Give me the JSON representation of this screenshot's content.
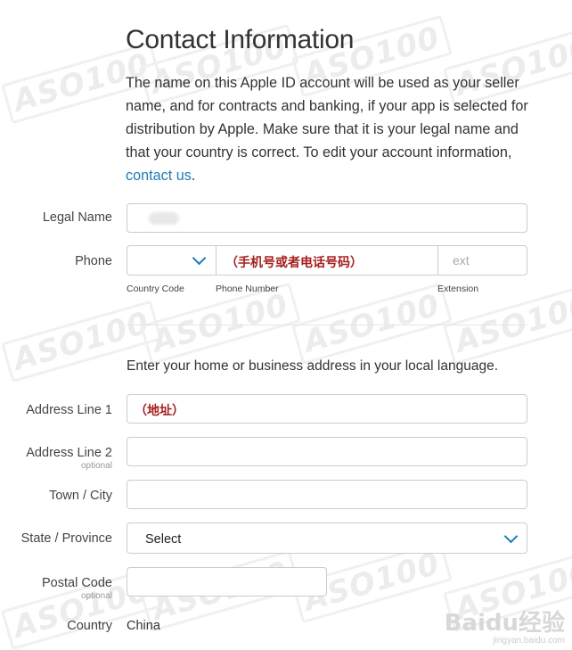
{
  "header": {
    "title": "Contact Information",
    "intro_before_link": "The name on this Apple ID account will be used as your seller name, and for contracts and banking, if your app is selected for distribution by Apple. Make sure that it is your legal name and that your country is correct. To edit your account information, ",
    "intro_link": "contact us",
    "intro_after_link": "."
  },
  "form": {
    "legal_name_label": "Legal Name",
    "phone_label": "Phone",
    "phone_number_overlay": "（手机号或者电话号码）",
    "ext_placeholder": "ext",
    "country_code_caption": "Country Code",
    "phone_number_caption": "Phone Number",
    "extension_caption": "Extension",
    "address_intro": "Enter your home or business address in your local language.",
    "address1_label": "Address Line 1",
    "address1_overlay": "（地址）",
    "address2_label": "Address Line 2",
    "optional_text": "optional",
    "town_label": "Town / City",
    "state_label": "State / Province",
    "state_value": "Select",
    "postal_label": "Postal Code",
    "country_label": "Country",
    "country_value": "China"
  },
  "watermark": {
    "text": "ASO100",
    "baidu_logo_text": "Baidu经验",
    "baidu_url": "jingyan.baidu.com"
  },
  "colors": {
    "link": "#1f7bb3",
    "overlay_red": "#a61e1e",
    "border": "#cccccc"
  }
}
